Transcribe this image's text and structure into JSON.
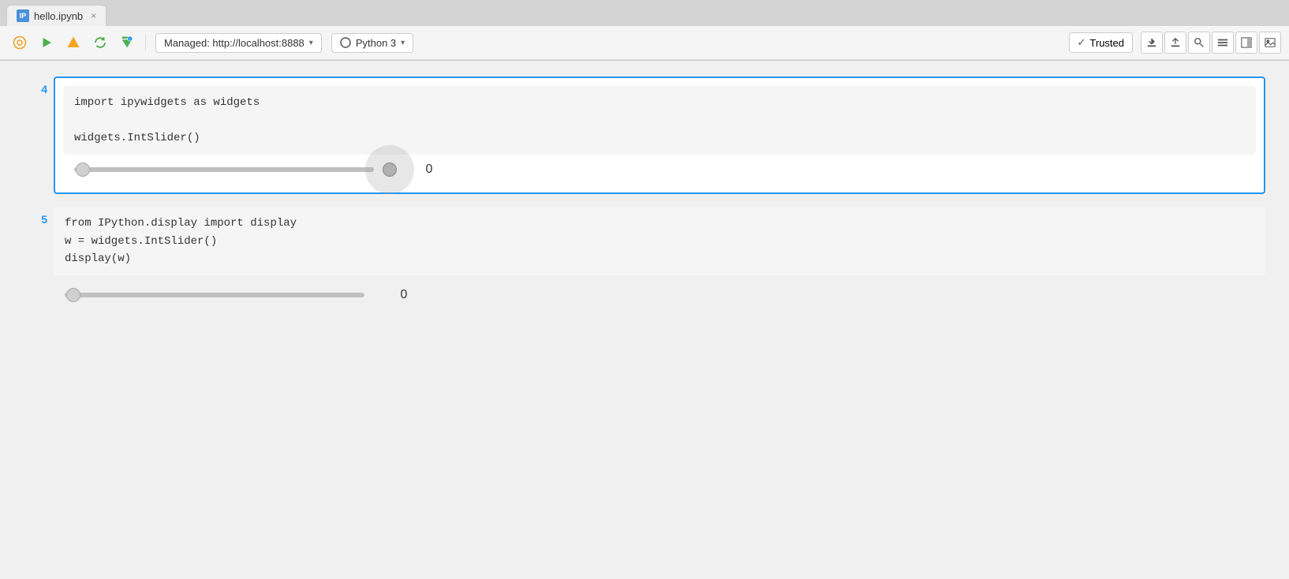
{
  "tab": {
    "label": "hello.ipynb",
    "icon": "IP",
    "close": "×"
  },
  "toolbar": {
    "save_icon": "💾",
    "run_icon": "▶",
    "interrupt_icon": "⚡",
    "restart_icon": "↺",
    "kernel_label": "Managed: http://localhost:8888",
    "kernel_arrow": "▾",
    "python_label": "Python 3",
    "python_arrow": "▾",
    "trusted_label": "Trusted",
    "download_icon": "⬇",
    "upload_icon": "⬆",
    "search_icon": "🔍",
    "menu_icon": "≡",
    "panel_icon": "▐",
    "image_icon": "🖼"
  },
  "cells": [
    {
      "number": "4",
      "active": true,
      "code_lines": [
        "import ipywidgets as widgets",
        "",
        "widgets.IntSlider()"
      ],
      "slider_value": "0"
    },
    {
      "number": "5",
      "active": false,
      "code_lines": [
        "from IPython.display import display",
        "w = widgets.IntSlider()",
        "display(w)"
      ],
      "slider_value": "0"
    }
  ]
}
